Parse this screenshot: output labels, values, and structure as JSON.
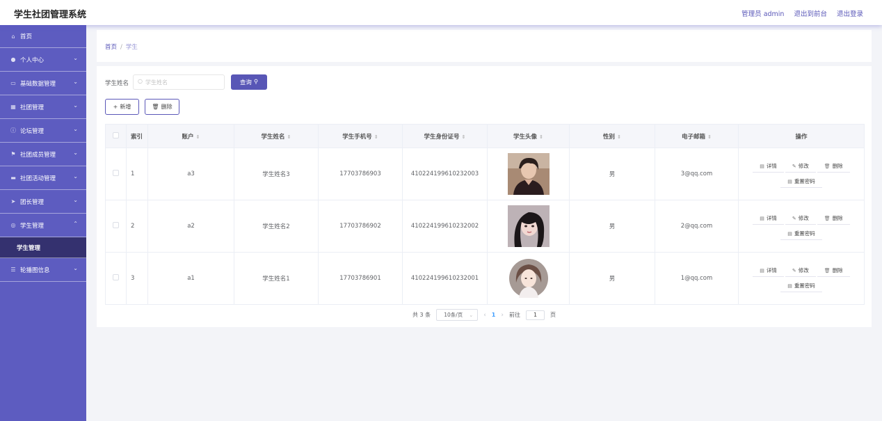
{
  "app": {
    "title": "学生社团管理系统",
    "header_links": [
      "管理员 admin",
      "退出到前台",
      "退出登录"
    ]
  },
  "sidebar": {
    "items": [
      {
        "label": "首页",
        "icon": "home-icon",
        "has_arrow": false
      },
      {
        "label": "个人中心",
        "icon": "user-icon",
        "has_arrow": true
      },
      {
        "label": "基础数据管理",
        "icon": "chat-icon",
        "has_arrow": true
      },
      {
        "label": "社团管理",
        "icon": "grid-icon",
        "has_arrow": true
      },
      {
        "label": "论坛管理",
        "icon": "info-icon",
        "has_arrow": true
      },
      {
        "label": "社团成员管理",
        "icon": "flag-icon",
        "has_arrow": true
      },
      {
        "label": "社团活动管理",
        "icon": "ticket-icon",
        "has_arrow": true
      },
      {
        "label": "团长管理",
        "icon": "send-icon",
        "has_arrow": true
      },
      {
        "label": "学生管理",
        "icon": "compass-icon",
        "has_arrow": true,
        "expanded": true
      },
      {
        "label": "轮播图信息",
        "icon": "list-icon",
        "has_arrow": true
      }
    ],
    "sub_item": "学生管理"
  },
  "breadcrumb": {
    "home": "首页",
    "separator": "/",
    "current": "学生"
  },
  "search": {
    "label": "学生姓名",
    "placeholder": "学生姓名",
    "value": "",
    "button": "查询"
  },
  "toolbar": {
    "add": "新增",
    "delete": "删除"
  },
  "table": {
    "headers": [
      "索引",
      "账户",
      "学生姓名",
      "学生手机号",
      "学生身份证号",
      "学生头像",
      "性别",
      "电子邮箱",
      "操作"
    ],
    "rows": [
      {
        "index": "1",
        "account": "a3",
        "name": "学生姓名3",
        "phone": "17703786903",
        "id_card": "410224199610232003",
        "gender": "男",
        "email": "3@qq.com"
      },
      {
        "index": "2",
        "account": "a2",
        "name": "学生姓名2",
        "phone": "17703786902",
        "id_card": "410224199610232002",
        "gender": "男",
        "email": "2@qq.com"
      },
      {
        "index": "3",
        "account": "a1",
        "name": "学生姓名1",
        "phone": "17703786901",
        "id_card": "410224199610232001",
        "gender": "男",
        "email": "1@qq.com"
      }
    ],
    "ops": {
      "detail": "详情",
      "edit": "修改",
      "delete": "删除",
      "reset": "重置密码"
    }
  },
  "pagination": {
    "total_text": "共 3 条",
    "page_size": "10条/页",
    "current_page": "1",
    "goto_label": "前往",
    "goto_value": "1",
    "page_unit": "页"
  },
  "colors": {
    "sidebar": "#5d5cc0",
    "sidebar_active": "#34316f",
    "accent": "#5856b6",
    "link": "#5a57b8"
  }
}
